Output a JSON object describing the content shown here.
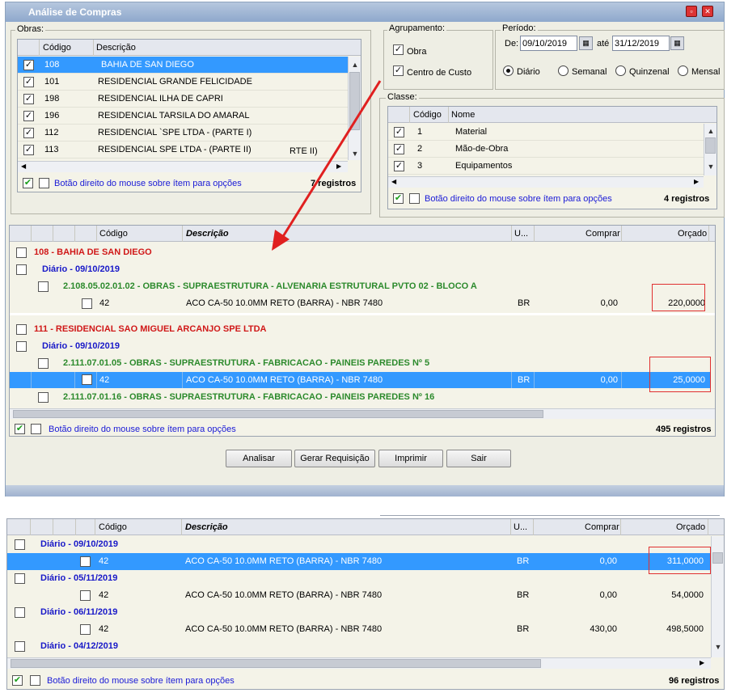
{
  "window": {
    "title": "Análise de Compras"
  },
  "obras": {
    "legend": "Obras:",
    "columns": [
      "Código",
      "Descrição"
    ],
    "rows": [
      {
        "codigo": "108",
        "descricao": "BAHIA DE SAN DIEGO",
        "checked": true,
        "selected": true
      },
      {
        "codigo": "101",
        "descricao": "RESIDENCIAL GRANDE FELICIDADE",
        "checked": true
      },
      {
        "codigo": "198",
        "descricao": "RESIDENCIAL ILHA DE CAPRI",
        "checked": true
      },
      {
        "codigo": "196",
        "descricao": "RESIDENCIAL TARSILA DO AMARAL",
        "checked": true
      },
      {
        "codigo": "112",
        "descricao": "RESIDENCIAL `SPE LTDA - (PARTE I)",
        "checked": true
      },
      {
        "codigo": "113",
        "descricao": "RESIDENCIAL SPE LTDA - (PARTE II)",
        "checked": true
      }
    ],
    "overflow_text": "RTE II)",
    "footer_hint": "Botão direito do mouse sobre ítem para opções",
    "footer_count": "7 registros"
  },
  "agrupamento": {
    "legend": "Agrupamento:",
    "options": [
      {
        "label": "Obra",
        "checked": true
      },
      {
        "label": "Centro de Custo",
        "checked": true
      }
    ]
  },
  "periodo": {
    "legend": "Período:",
    "de_label": "De:",
    "de_value": "09/10/2019",
    "ate_label": "até",
    "ate_value": "31/12/2019",
    "radios": [
      {
        "label": "Diário",
        "selected": true
      },
      {
        "label": "Semanal",
        "selected": false
      },
      {
        "label": "Quinzenal",
        "selected": false
      },
      {
        "label": "Mensal",
        "selected": false
      }
    ]
  },
  "classe": {
    "legend": "Classe:",
    "columns": [
      "Código",
      "Nome"
    ],
    "rows": [
      {
        "codigo": "1",
        "nome": "Material",
        "checked": true
      },
      {
        "codigo": "2",
        "nome": "Mão-de-Obra",
        "checked": true
      },
      {
        "codigo": "3",
        "nome": "Equipamentos",
        "checked": true
      }
    ],
    "footer_hint": "Botão direito do mouse sobre ítem para opções",
    "footer_count": "4 registros"
  },
  "main_grid": {
    "columns": {
      "codigo": "Código",
      "descricao": "Descrição",
      "u": "U...",
      "comprar": "Comprar",
      "orcado": "Orçado"
    },
    "part_a": {
      "obra": "108 - BAHIA DE SAN DIEGO",
      "diario": "Diário - 09/10/2019",
      "centro": "2.108.05.02.01.02 - OBRAS - SUPRAESTRUTURA - ALVENARIA ESTRUTURAL PVTO 02 - BLOCO A",
      "item": {
        "codigo": "42",
        "descricao": "ACO CA-50 10.0MM RETO (BARRA) - NBR 7480",
        "u": "BR",
        "comprar": "0,00",
        "orcado": "220,0000"
      }
    },
    "part_b": {
      "obra": "111 - RESIDENCIAL SAO MIGUEL ARCANJO SPE LTDA",
      "diario": "Diário - 09/10/2019",
      "centro1": "2.111.07.01.05 - OBRAS - SUPRAESTRUTURA - FABRICACAO - PAINEIS PAREDES Nº 5",
      "item": {
        "codigo": "42",
        "descricao": "ACO CA-50 10.0MM RETO (BARRA) - NBR 7480",
        "u": "BR",
        "comprar": "0,00",
        "orcado": "25,0000"
      },
      "centro2": "2.111.07.01.16 - OBRAS - SUPRAESTRUTURA - FABRICACAO - PAINEIS PAREDES Nº 16"
    },
    "footer_hint": "Botão direito do mouse sobre ítem para opções",
    "footer_count": "495 registros"
  },
  "buttons": {
    "analisar": "Analisar",
    "gerar": "Gerar Requisição",
    "imprimir": "Imprimir",
    "sair": "Sair"
  },
  "second_grid": {
    "columns": {
      "codigo": "Código",
      "descricao": "Descrição",
      "u": "U...",
      "comprar": "Comprar",
      "orcado": "Orçado"
    },
    "rows": [
      {
        "type": "diario",
        "text": "Diário - 09/10/2019"
      },
      {
        "type": "item",
        "codigo": "42",
        "descricao": "ACO CA-50 10.0MM RETO (BARRA) - NBR 7480",
        "u": "BR",
        "comprar": "0,00",
        "orcado": "311,0000",
        "selected": true
      },
      {
        "type": "diario",
        "text": "Diário - 05/11/2019"
      },
      {
        "type": "item",
        "codigo": "42",
        "descricao": "ACO CA-50 10.0MM RETO (BARRA) - NBR 7480",
        "u": "BR",
        "comprar": "0,00",
        "orcado": "54,0000"
      },
      {
        "type": "diario",
        "text": "Diário - 06/11/2019"
      },
      {
        "type": "item",
        "codigo": "42",
        "descricao": "ACO CA-50 10.0MM RETO (BARRA) - NBR 7480",
        "u": "BR",
        "comprar": "430,00",
        "orcado": "498,5000"
      },
      {
        "type": "diario",
        "text": "Diário - 04/12/2019"
      }
    ],
    "footer_hint": "Botão direito do mouse sobre ítem para opções",
    "footer_count": "96 registros"
  },
  "colors": {
    "selection": "#3399ff",
    "obra_text": "#d01818",
    "diario_text": "#1818c8",
    "centro_text": "#2c8a2c",
    "highlight_box": "#e03030",
    "arrow": "#e02020"
  }
}
